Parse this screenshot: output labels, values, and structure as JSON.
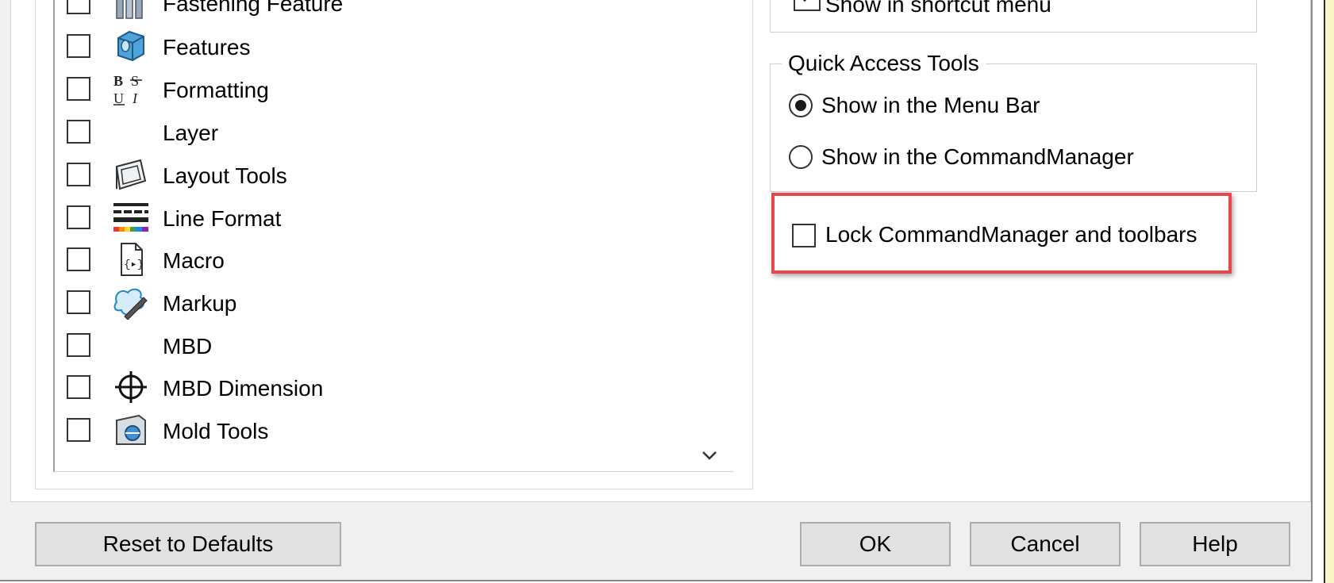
{
  "toolbars": {
    "items": [
      {
        "label": "Fastening Feature",
        "checked": false,
        "icon": "fastening-feature-icon"
      },
      {
        "label": "Features",
        "checked": false,
        "icon": "features-icon"
      },
      {
        "label": "Formatting",
        "checked": false,
        "icon": "formatting-icon"
      },
      {
        "label": "Layer",
        "checked": false,
        "icon": ""
      },
      {
        "label": "Layout Tools",
        "checked": false,
        "icon": "layout-tools-icon"
      },
      {
        "label": "Line Format",
        "checked": false,
        "icon": "line-format-icon"
      },
      {
        "label": "Macro",
        "checked": false,
        "icon": "macro-icon"
      },
      {
        "label": "Markup",
        "checked": false,
        "icon": "markup-icon"
      },
      {
        "label": "MBD",
        "checked": false,
        "icon": ""
      },
      {
        "label": "MBD Dimension",
        "checked": false,
        "icon": "mbd-dimension-icon"
      },
      {
        "label": "Mold Tools",
        "checked": false,
        "icon": "mold-tools-icon"
      }
    ]
  },
  "shortcut": {
    "label": "Show in shortcut menu",
    "checked": true
  },
  "quick_access": {
    "legend": "Quick Access Tools",
    "options": [
      {
        "label": "Show in the Menu Bar",
        "selected": true
      },
      {
        "label": "Show in the CommandManager",
        "selected": false
      }
    ]
  },
  "lock": {
    "label": "Lock CommandManager and toolbars",
    "checked": false
  },
  "buttons": {
    "reset": "Reset to Defaults",
    "ok": "OK",
    "cancel": "Cancel",
    "help": "Help"
  },
  "colors": {
    "highlight": "#e8474e",
    "accent_blue": "#1e88c8"
  }
}
